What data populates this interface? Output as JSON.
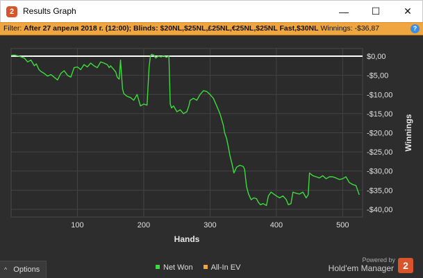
{
  "window": {
    "title": "Results Graph",
    "app_badge": "2",
    "minimize_glyph": "—",
    "maximize_glyph": "☐",
    "close_glyph": "✕"
  },
  "filter": {
    "prefix": "Filter:",
    "text": "After 27 апреля 2018 г. (12:00); Blinds: $20NL,$25NL,£25NL,€25NL,$25NL Fast,$30NL",
    "winnings_label": "Winnings:",
    "winnings_value": "-$36,87",
    "help_glyph": "?"
  },
  "bottom": {
    "options_label": "Options",
    "options_chevron": "^",
    "legend": [
      {
        "label": "Net Won",
        "color": "#3ddc3d"
      },
      {
        "label": "All-In EV",
        "color": "#f0a640"
      }
    ],
    "powered_by": "Powered by",
    "brand_name": "Hold'em Manager",
    "brand_badge": "2"
  },
  "colors": {
    "accent_orange": "#f0a640",
    "plot_bg": "#2d2d2d",
    "line_net_won": "#3ddc3d",
    "zero_line": "#ffffff"
  },
  "chart_data": {
    "type": "line",
    "xlabel": "Hands",
    "ylabel": "Winnings",
    "xlim": [
      0,
      530
    ],
    "ylim": [
      -42,
      2
    ],
    "x_ticks": [
      100,
      200,
      300,
      400,
      500
    ],
    "y_ticks": [
      {
        "value": 0,
        "label": "$0,00"
      },
      {
        "value": -5,
        "label": "-$5,00"
      },
      {
        "value": -10,
        "label": "-$10,00"
      },
      {
        "value": -15,
        "label": "-$15,00"
      },
      {
        "value": -20,
        "label": "-$20,00"
      },
      {
        "value": -25,
        "label": "-$25,00"
      },
      {
        "value": -30,
        "label": "-$30,00"
      },
      {
        "value": -35,
        "label": "-$35,00"
      },
      {
        "value": -40,
        "label": "-$40,00"
      }
    ],
    "grid": true,
    "series": [
      {
        "name": "Net Won",
        "x": [
          0,
          5,
          12,
          20,
          25,
          30,
          35,
          38,
          42,
          45,
          50,
          55,
          60,
          65,
          70,
          75,
          80,
          85,
          90,
          95,
          100,
          105,
          110,
          115,
          120,
          125,
          130,
          135,
          140,
          145,
          148,
          150,
          155,
          158,
          160,
          163,
          165,
          168,
          170,
          175,
          180,
          185,
          190,
          195,
          200,
          205,
          208,
          210,
          212,
          215,
          218,
          222,
          226,
          230,
          234,
          238,
          240,
          242,
          245,
          250,
          255,
          260,
          265,
          268,
          270,
          275,
          280,
          285,
          290,
          295,
          300,
          305,
          310,
          315,
          320,
          322,
          325,
          328,
          330,
          333,
          336,
          340,
          345,
          350,
          352,
          355,
          358,
          362,
          366,
          370,
          373,
          376,
          380,
          385,
          388,
          392,
          396,
          400,
          405,
          410,
          415,
          418,
          422,
          425,
          430,
          435,
          440,
          445,
          448,
          450,
          455,
          460,
          465,
          470,
          475,
          480,
          485,
          490,
          495,
          500,
          505,
          510,
          515,
          520,
          525
        ],
        "y": [
          0.2,
          0.3,
          0.0,
          -0.5,
          -1.5,
          -1.0,
          -2.5,
          -2.0,
          -3.5,
          -4.0,
          -4.5,
          -5.2,
          -4.8,
          -5.5,
          -6.2,
          -4.5,
          -3.8,
          -5.0,
          -5.5,
          -3.0,
          -2.8,
          -3.5,
          -2.2,
          -2.8,
          -1.8,
          -2.5,
          -3.0,
          -1.5,
          -1.8,
          -2.2,
          -3.0,
          -2.5,
          -3.5,
          -4.2,
          -5.5,
          -6.0,
          -1.0,
          -8.5,
          -9.8,
          -10.5,
          -10.8,
          -11.5,
          -10.0,
          -13.0,
          -12.5,
          -12.8,
          -3.0,
          0.0,
          0.5,
          0.3,
          -0.5,
          0.0,
          -0.2,
          0.1,
          -0.3,
          0.0,
          -12.5,
          -13.5,
          -13.0,
          -14.5,
          -14.0,
          -15.0,
          -14.5,
          -13.0,
          -11.5,
          -11.0,
          -11.5,
          -10.0,
          -9.0,
          -9.2,
          -10.0,
          -11.0,
          -13.0,
          -15.0,
          -18.0,
          -20.0,
          -21.5,
          -24.0,
          -26.0,
          -28.0,
          -30.5,
          -29.0,
          -28.5,
          -28.8,
          -29.5,
          -34.0,
          -36.0,
          -37.5,
          -37.0,
          -37.2,
          -38.2,
          -38.8,
          -38.5,
          -39.0,
          -36.5,
          -35.5,
          -36.0,
          -36.5,
          -37.0,
          -36.5,
          -37.5,
          -38.8,
          -38.5,
          -35.5,
          -35.8,
          -36.0,
          -35.5,
          -37.0,
          -36.2,
          -30.5,
          -31.2,
          -31.5,
          -31.8,
          -31.2,
          -32.0,
          -31.5,
          -31.5,
          -31.8,
          -32.2,
          -32.0,
          -31.5,
          -33.0,
          -33.5,
          -33.8,
          -36.2
        ]
      }
    ]
  }
}
